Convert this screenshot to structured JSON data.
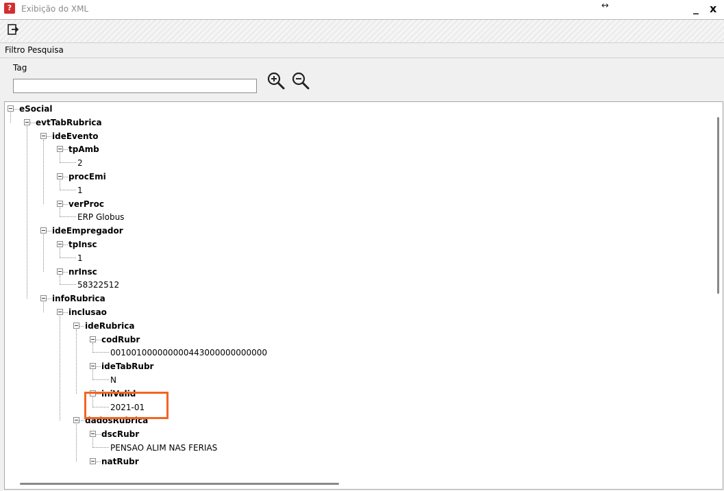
{
  "window": {
    "title": "Exibição do XML",
    "app_icon_glyph": "?",
    "resize_glyph": "↔",
    "minimize_glyph": "_",
    "close_glyph": "x"
  },
  "toolbar": {
    "exit_icon": "exit-icon"
  },
  "filter": {
    "section_label": "Filtro Pesquisa",
    "tag_label": "Tag",
    "tag_value": "",
    "zoom_in_icon": "zoom-in-icon",
    "zoom_out_icon": "zoom-out-icon"
  },
  "tree": {
    "highlight_color": "#f26522",
    "nodes": [
      {
        "text": "eSocial",
        "kind": "tag"
      },
      {
        "text": "evtTabRubrica",
        "kind": "tag"
      },
      {
        "text": "ideEvento",
        "kind": "tag"
      },
      {
        "text": "tpAmb",
        "kind": "tag"
      },
      {
        "text": "2",
        "kind": "value"
      },
      {
        "text": "procEmi",
        "kind": "tag"
      },
      {
        "text": "1",
        "kind": "value"
      },
      {
        "text": "verProc",
        "kind": "tag"
      },
      {
        "text": "ERP Globus",
        "kind": "value"
      },
      {
        "text": "ideEmpregador",
        "kind": "tag"
      },
      {
        "text": "tpInsc",
        "kind": "tag"
      },
      {
        "text": "1",
        "kind": "value"
      },
      {
        "text": "nrInsc",
        "kind": "tag"
      },
      {
        "text": "58322512",
        "kind": "value"
      },
      {
        "text": "infoRubrica",
        "kind": "tag"
      },
      {
        "text": "inclusao",
        "kind": "tag"
      },
      {
        "text": "ideRubrica",
        "kind": "tag"
      },
      {
        "text": "codRubr",
        "kind": "tag"
      },
      {
        "text": "001001000000000443000000000000",
        "kind": "value"
      },
      {
        "text": "ideTabRubr",
        "kind": "tag"
      },
      {
        "text": "N",
        "kind": "value"
      },
      {
        "text": "iniValid",
        "kind": "tag"
      },
      {
        "text": "2021-01",
        "kind": "value"
      },
      {
        "text": "dadosRubrica",
        "kind": "tag"
      },
      {
        "text": "dscRubr",
        "kind": "tag"
      },
      {
        "text": "PENSAO ALIM NAS FERIAS",
        "kind": "value"
      },
      {
        "text": "natRubr",
        "kind": "tag"
      }
    ]
  }
}
